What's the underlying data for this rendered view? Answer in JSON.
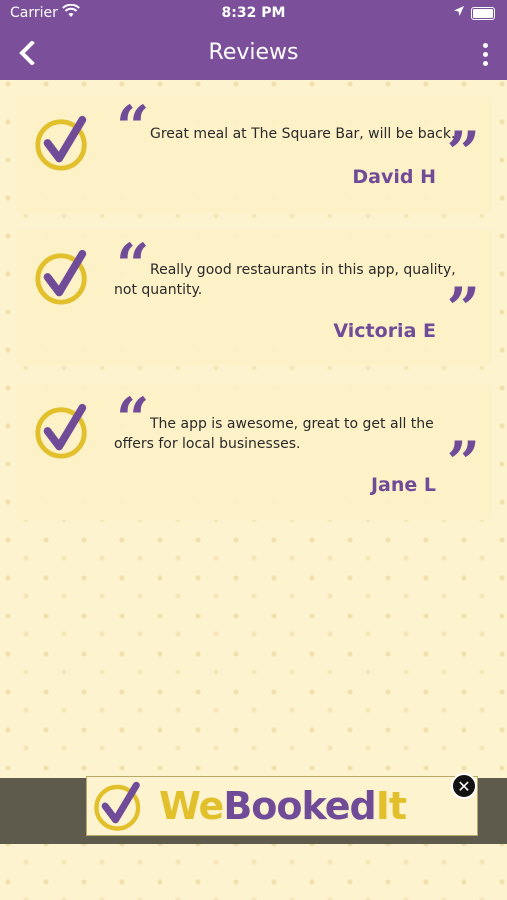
{
  "status_bar": {
    "carrier": "Carrier",
    "time": "8:32 PM"
  },
  "nav": {
    "title": "Reviews"
  },
  "reviews": [
    {
      "text": "Great meal at The Square Bar, will be back.",
      "author": "David H"
    },
    {
      "text": "Really good restaurants in this app, quality, not quantity.",
      "author": "Victoria E"
    },
    {
      "text": "The app is awesome, great to get all the offers for local businesses.",
      "author": "Jane L"
    }
  ],
  "ad": {
    "brand_we": "We",
    "brand_booked": "Booked",
    "brand_it": "It"
  },
  "colors": {
    "primary": "#7b4f9a",
    "accent_yellow": "#e1c02b",
    "background": "#fdf3cf"
  }
}
